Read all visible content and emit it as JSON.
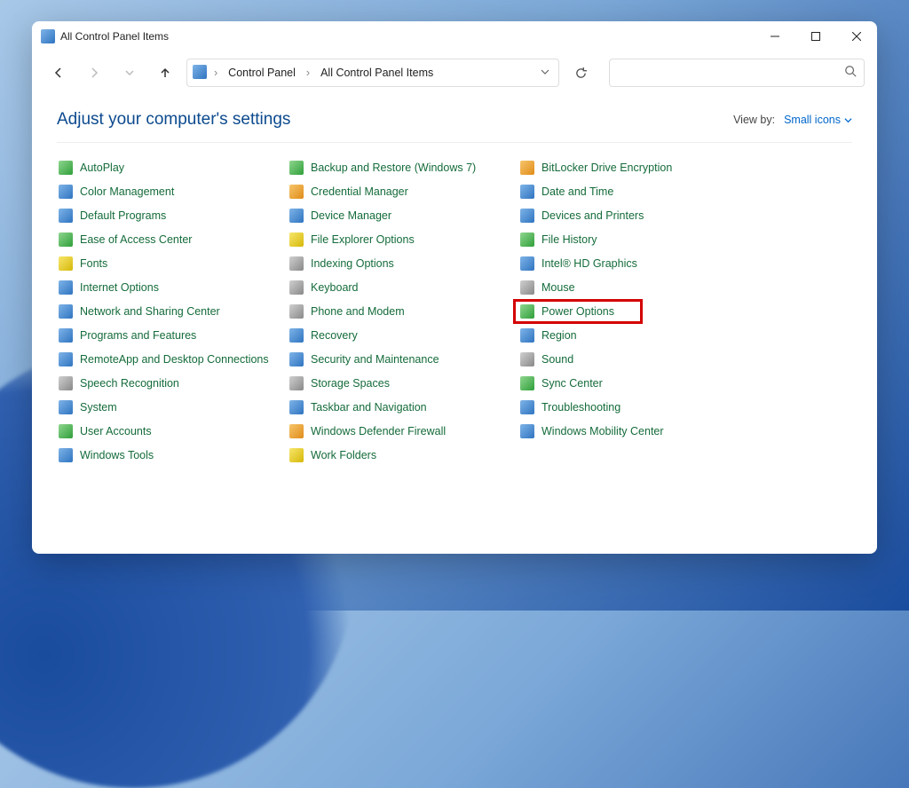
{
  "window": {
    "title": "All Control Panel Items"
  },
  "breadcrumb": {
    "root": "Control Panel",
    "current": "All Control Panel Items"
  },
  "search": {
    "placeholder": ""
  },
  "heading": "Adjust your computer's settings",
  "viewby": {
    "label": "View by:",
    "value": "Small icons"
  },
  "columns": [
    [
      {
        "label": "AutoPlay",
        "icon": "green"
      },
      {
        "label": "Color Management",
        "icon": "blue"
      },
      {
        "label": "Default Programs",
        "icon": "blue"
      },
      {
        "label": "Ease of Access Center",
        "icon": "green"
      },
      {
        "label": "Fonts",
        "icon": "yellow"
      },
      {
        "label": "Internet Options",
        "icon": "blue"
      },
      {
        "label": "Network and Sharing Center",
        "icon": "blue"
      },
      {
        "label": "Programs and Features",
        "icon": "blue"
      },
      {
        "label": "RemoteApp and Desktop Connections",
        "icon": "blue"
      },
      {
        "label": "Speech Recognition",
        "icon": "gray"
      },
      {
        "label": "System",
        "icon": "blue"
      },
      {
        "label": "User Accounts",
        "icon": "green"
      },
      {
        "label": "Windows Tools",
        "icon": "blue"
      }
    ],
    [
      {
        "label": "Backup and Restore (Windows 7)",
        "icon": "green"
      },
      {
        "label": "Credential Manager",
        "icon": "orange"
      },
      {
        "label": "Device Manager",
        "icon": "blue"
      },
      {
        "label": "File Explorer Options",
        "icon": "yellow"
      },
      {
        "label": "Indexing Options",
        "icon": "gray"
      },
      {
        "label": "Keyboard",
        "icon": "gray"
      },
      {
        "label": "Phone and Modem",
        "icon": "gray"
      },
      {
        "label": "Recovery",
        "icon": "blue"
      },
      {
        "label": "Security and Maintenance",
        "icon": "blue"
      },
      {
        "label": "Storage Spaces",
        "icon": "gray"
      },
      {
        "label": "Taskbar and Navigation",
        "icon": "blue"
      },
      {
        "label": "Windows Defender Firewall",
        "icon": "orange"
      },
      {
        "label": "Work Folders",
        "icon": "yellow"
      }
    ],
    [
      {
        "label": "BitLocker Drive Encryption",
        "icon": "orange"
      },
      {
        "label": "Date and Time",
        "icon": "blue"
      },
      {
        "label": "Devices and Printers",
        "icon": "blue"
      },
      {
        "label": "File History",
        "icon": "green"
      },
      {
        "label": "Intel® HD Graphics",
        "icon": "blue"
      },
      {
        "label": "Mouse",
        "icon": "gray"
      },
      {
        "label": "Power Options",
        "icon": "green",
        "highlight": true
      },
      {
        "label": "Region",
        "icon": "blue"
      },
      {
        "label": "Sound",
        "icon": "gray"
      },
      {
        "label": "Sync Center",
        "icon": "green"
      },
      {
        "label": "Troubleshooting",
        "icon": "blue"
      },
      {
        "label": "Windows Mobility Center",
        "icon": "blue"
      }
    ]
  ]
}
